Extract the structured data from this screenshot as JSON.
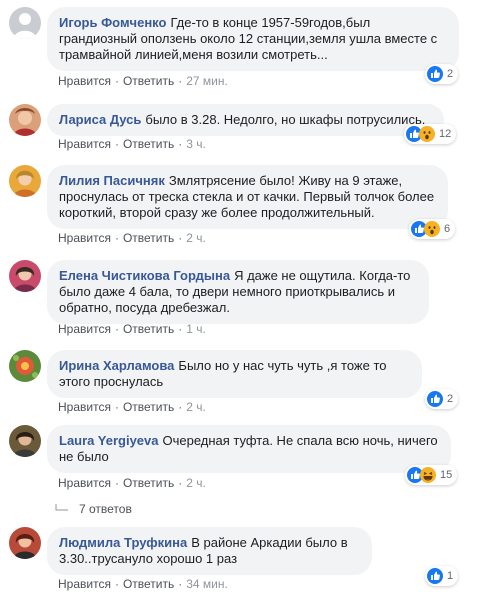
{
  "comments": [
    {
      "author": "Игорь Фомченко",
      "text": "Где-то в конце 1957-59годов,был грандиозный оползень около 12 станции,земля ушла вместе с трамвайной линией,меня возили смотреть...",
      "like": "Нравится",
      "reply": "Ответить",
      "time": "27 мин.",
      "reactions": {
        "types": [
          "like-icon"
        ],
        "count": "2"
      }
    },
    {
      "author": "Лариса Дусь",
      "text": "было в 3.28. Недолго, но шкафы потрусились.",
      "like": "Нравится",
      "reply": "Ответить",
      "time": "3 ч.",
      "reactions": {
        "types": [
          "like-icon",
          "wow-icon"
        ],
        "count": "12"
      }
    },
    {
      "author": "Лилия Пасичняк",
      "text": "Змлятрясение было! Живу на 9 этаже, проснулась от треска стекла и от качки. Первый толчок более короткий, второй сразу же более продолжительный.",
      "like": "Нравится",
      "reply": "Ответить",
      "time": "2 ч.",
      "reactions": {
        "types": [
          "like-icon",
          "wow-icon"
        ],
        "count": "6"
      }
    },
    {
      "author": "Елена Чистикова Гордына",
      "text": "Я даже не ощутила. Когда-то было даже 4 бала, то двери немного приоткрывались и обратно, посуда дребезжал.",
      "like": "Нравится",
      "reply": "Ответить",
      "time": "1 ч.",
      "reactions": null
    },
    {
      "author": "Ирина Харламова",
      "text": "Было но у нас чуть чуть ,я тоже то этого проснулась",
      "like": "Нравится",
      "reply": "Ответить",
      "time": "2 ч.",
      "reactions": {
        "types": [
          "like-icon"
        ],
        "count": "2"
      }
    },
    {
      "author": "Laura Yergiyeva",
      "text": "Очередная туфта. Не спала всю ночь, ничего не было",
      "like": "Нравится",
      "reply": "Ответить",
      "time": "2 ч.",
      "reactions": {
        "types": [
          "like-icon",
          "haha-icon"
        ],
        "count": "15"
      }
    },
    {
      "author": "Людмила Труфкина",
      "text": "В районе Аркадии было в 3.30..трусануло хорошо 1 раз",
      "like": "Нравится",
      "reply": "Ответить",
      "time": "34 мин.",
      "reactions": {
        "types": [
          "like-icon"
        ],
        "count": "1"
      }
    }
  ],
  "replies_link": "7 ответов",
  "colors": {
    "link": "#385898",
    "like_blue": "#1877f2",
    "bubble": "#f2f3f5",
    "wow_yellow": "#f7b125"
  }
}
